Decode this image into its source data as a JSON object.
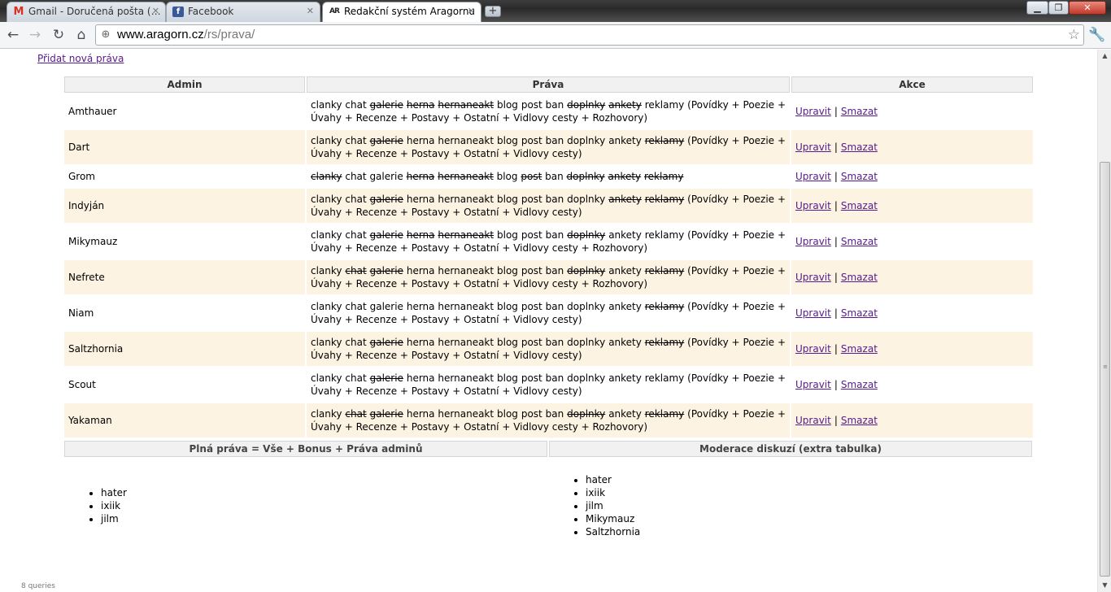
{
  "browser": {
    "tabs": [
      {
        "title": "Gmail - Doručená pošta (…",
        "icon": "gmail-icon",
        "active": false
      },
      {
        "title": "Facebook",
        "icon": "facebook-icon",
        "active": false
      },
      {
        "title": "Redakční systém Aragornu",
        "icon": "aragorn-icon",
        "active": true
      }
    ],
    "url_host": "www.aragorn.cz",
    "url_path": "/rs/prava/"
  },
  "page": {
    "add_link": "Přidat nová práva",
    "headers": {
      "admin": "Admin",
      "rights": "Práva",
      "actions": "Akce"
    },
    "action_edit": "Upravit",
    "action_sep": "|",
    "action_delete": "Smazat",
    "rows": [
      {
        "name": "Amthauer",
        "perms": [
          [
            "clanky",
            1
          ],
          [
            "chat",
            1
          ],
          [
            "galerie",
            0
          ],
          [
            "herna",
            0
          ],
          [
            "hernaneakt",
            0
          ],
          [
            "blog",
            1
          ],
          [
            "post",
            1
          ],
          [
            "ban",
            1
          ],
          [
            "doplnky",
            0
          ],
          [
            "ankety",
            0
          ],
          [
            "reklamy",
            1
          ]
        ],
        "extra": "(Povídky + Poezie + Úvahy + Recenze + Postavy + Ostatní + Vidlovy cesty + Rozhovory)"
      },
      {
        "name": "Dart",
        "perms": [
          [
            "clanky",
            1
          ],
          [
            "chat",
            1
          ],
          [
            "galerie",
            0
          ],
          [
            "herna",
            1
          ],
          [
            "hernaneakt",
            1
          ],
          [
            "blog",
            1
          ],
          [
            "post",
            1
          ],
          [
            "ban",
            1
          ],
          [
            "doplnky",
            1
          ],
          [
            "ankety",
            1
          ],
          [
            "reklamy",
            0
          ]
        ],
        "extra": "(Povídky + Poezie + Úvahy + Recenze + Postavy + Ostatní + Vidlovy cesty)"
      },
      {
        "name": "Grom",
        "perms": [
          [
            "clanky",
            0
          ],
          [
            "chat",
            1
          ],
          [
            "galerie",
            1
          ],
          [
            "herna",
            0
          ],
          [
            "hernaneakt",
            0
          ],
          [
            "blog",
            1
          ],
          [
            "post",
            0
          ],
          [
            "ban",
            1
          ],
          [
            "doplnky",
            0
          ],
          [
            "ankety",
            0
          ],
          [
            "reklamy",
            0
          ]
        ],
        "extra": ""
      },
      {
        "name": "Indyján",
        "perms": [
          [
            "clanky",
            1
          ],
          [
            "chat",
            1
          ],
          [
            "galerie",
            0
          ],
          [
            "herna",
            1
          ],
          [
            "hernaneakt",
            1
          ],
          [
            "blog",
            1
          ],
          [
            "post",
            1
          ],
          [
            "ban",
            1
          ],
          [
            "doplnky",
            1
          ],
          [
            "ankety",
            0
          ],
          [
            "reklamy",
            0
          ]
        ],
        "extra": "(Povídky + Poezie + Úvahy + Recenze + Postavy + Ostatní + Vidlovy cesty)"
      },
      {
        "name": "Mikymauz",
        "perms": [
          [
            "clanky",
            1
          ],
          [
            "chat",
            1
          ],
          [
            "galerie",
            0
          ],
          [
            "herna",
            0
          ],
          [
            "hernaneakt",
            0
          ],
          [
            "blog",
            1
          ],
          [
            "post",
            1
          ],
          [
            "ban",
            1
          ],
          [
            "doplnky",
            0
          ],
          [
            "ankety",
            1
          ],
          [
            "reklamy",
            1
          ]
        ],
        "extra": "(Povídky + Poezie + Úvahy + Recenze + Postavy + Ostatní + Vidlovy cesty + Rozhovory)"
      },
      {
        "name": "Nefrete",
        "perms": [
          [
            "clanky",
            1
          ],
          [
            "chat",
            0
          ],
          [
            "galerie",
            0
          ],
          [
            "herna",
            1
          ],
          [
            "hernaneakt",
            1
          ],
          [
            "blog",
            1
          ],
          [
            "post",
            1
          ],
          [
            "ban",
            1
          ],
          [
            "doplnky",
            0
          ],
          [
            "ankety",
            1
          ],
          [
            "reklamy",
            0
          ]
        ],
        "extra": "(Povídky + Poezie + Úvahy + Recenze + Postavy + Ostatní + Vidlovy cesty + Rozhovory)"
      },
      {
        "name": "Niam",
        "perms": [
          [
            "clanky",
            1
          ],
          [
            "chat",
            1
          ],
          [
            "galerie",
            1
          ],
          [
            "herna",
            1
          ],
          [
            "hernaneakt",
            1
          ],
          [
            "blog",
            1
          ],
          [
            "post",
            1
          ],
          [
            "ban",
            1
          ],
          [
            "doplnky",
            1
          ],
          [
            "ankety",
            1
          ],
          [
            "reklamy",
            0
          ]
        ],
        "extra": "(Povídky + Poezie + Úvahy + Recenze + Postavy + Ostatní + Vidlovy cesty)"
      },
      {
        "name": "Saltzhornia",
        "perms": [
          [
            "clanky",
            1
          ],
          [
            "chat",
            1
          ],
          [
            "galerie",
            0
          ],
          [
            "herna",
            1
          ],
          [
            "hernaneakt",
            1
          ],
          [
            "blog",
            1
          ],
          [
            "post",
            1
          ],
          [
            "ban",
            1
          ],
          [
            "doplnky",
            1
          ],
          [
            "ankety",
            1
          ],
          [
            "reklamy",
            0
          ]
        ],
        "extra": "(Povídky + Poezie + Úvahy + Recenze + Postavy + Ostatní + Vidlovy cesty)"
      },
      {
        "name": "Scout",
        "perms": [
          [
            "clanky",
            1
          ],
          [
            "chat",
            1
          ],
          [
            "galerie",
            0
          ],
          [
            "herna",
            1
          ],
          [
            "hernaneakt",
            1
          ],
          [
            "blog",
            1
          ],
          [
            "post",
            1
          ],
          [
            "ban",
            1
          ],
          [
            "doplnky",
            1
          ],
          [
            "ankety",
            1
          ],
          [
            "reklamy",
            1
          ]
        ],
        "extra": "(Povídky + Poezie + Úvahy + Recenze + Postavy + Ostatní + Vidlovy cesty)"
      },
      {
        "name": "Yakaman",
        "perms": [
          [
            "clanky",
            1
          ],
          [
            "chat",
            0
          ],
          [
            "galerie",
            0
          ],
          [
            "herna",
            1
          ],
          [
            "hernaneakt",
            1
          ],
          [
            "blog",
            1
          ],
          [
            "post",
            1
          ],
          [
            "ban",
            1
          ],
          [
            "doplnky",
            0
          ],
          [
            "ankety",
            1
          ],
          [
            "reklamy",
            0
          ]
        ],
        "extra": "(Povídky + Poezie + Úvahy + Recenze + Postavy + Ostatní + Vidlovy cesty + Rozhovory)"
      }
    ],
    "full_rights": {
      "title": "Plná práva = Vše + Bonus + Práva adminů",
      "users": [
        "hater",
        "ixiik",
        "jilm"
      ]
    },
    "moderation": {
      "title": "Moderace diskuzí (extra tabulka)",
      "users": [
        "hater",
        "ixiik",
        "jilm",
        "Mikymauz",
        "Saltzhornia"
      ]
    },
    "footer": "8 queries"
  }
}
